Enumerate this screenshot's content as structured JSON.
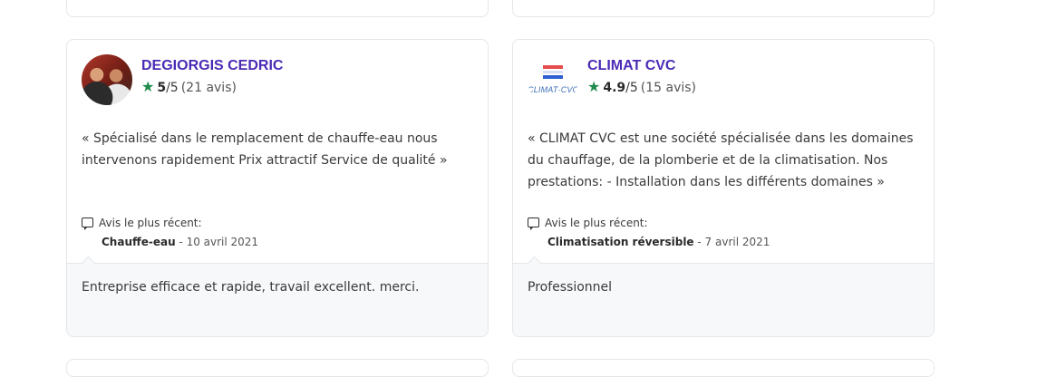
{
  "cards": [
    {
      "avatar_kind": "photo",
      "company": "DEGIORGIS CEDRIC",
      "score": "5",
      "max": "/5",
      "reviews": "(21 avis)",
      "description": "« Spécialisé dans le remplacement de chauffe-eau nous intervenons rapidement Prix attractif Service de qualité »",
      "recent_label": "Avis le plus récent:",
      "recent_category": "Chauffe-eau",
      "recent_date": " - 10 avril 2021",
      "review_text": "Entreprise efficace et rapide, travail excellent. merci."
    },
    {
      "avatar_kind": "logo",
      "logo_text": "CLIMAT·CVC",
      "company": "CLIMAT CVC",
      "score": "4.9",
      "max": "/5",
      "reviews": "(15 avis)",
      "description": "« CLIMAT CVC est une société spécialisée dans les domaines du chauffage, de la plomberie et de la climatisation. Nos prestations: - Installation dans les différents domaines »",
      "recent_label": "Avis le plus récent:",
      "recent_category": "Climatisation réversible",
      "recent_date": " - 7 avril 2021",
      "review_text": "Professionnel"
    }
  ],
  "icons": {
    "star": "★",
    "recent": "review-bubble-icon"
  },
  "colors": {
    "company_name": "#4b2bb5",
    "star": "#1f8a4c"
  }
}
